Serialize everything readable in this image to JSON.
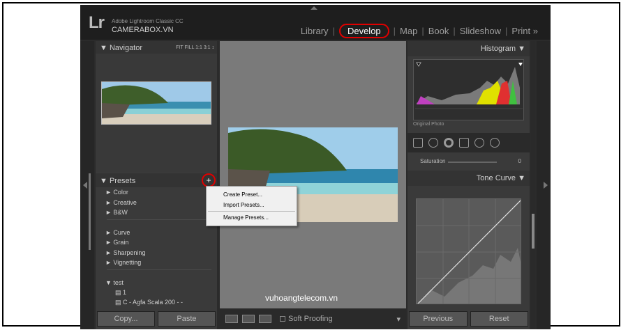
{
  "topbar": {
    "logo": "Lr",
    "app_name": "Adobe Lightroom Classic CC",
    "user": "CAMERABOX.VN",
    "modules": [
      "Library",
      "Develop",
      "Map",
      "Book",
      "Slideshow",
      "Print »"
    ],
    "active_module": "Develop"
  },
  "left": {
    "navigator": {
      "title": "▼  Navigator",
      "options": "FIT  FILL  1:1  3:1 ↕"
    },
    "presets": {
      "title": "▼  Presets",
      "add_button": "+",
      "groups_a": [
        "►  Color",
        "►  Creative",
        "►  B&W"
      ],
      "groups_b": [
        "►  Curve",
        "►  Grain",
        "►  Sharpening",
        "►  Vignetting"
      ],
      "user_group": "▼  test",
      "user_items": [
        "▤  1",
        "▤  C - Agfa Scala 200 - -"
      ]
    },
    "copy_button": "Copy...",
    "paste_button": "Paste"
  },
  "context_menu": {
    "items": [
      "Create Preset...",
      "Import Presets...",
      "Manage Presets..."
    ]
  },
  "center": {
    "watermark": "vuhoangtelecom.vn"
  },
  "toolbar": {
    "soft_proofing": "Soft Proofing"
  },
  "right": {
    "histogram_title": "Histogram  ▼",
    "original_photo": "Original Photo",
    "saturation_label": "Saturation",
    "saturation_value": "0",
    "tone_curve_title": "Tone Curve  ▼",
    "previous_button": "Previous",
    "reset_button": "Reset"
  },
  "colors": {
    "active_highlight": "#e00000",
    "panel_bg": "#3a3a3a",
    "app_bg": "#1e1e1e"
  }
}
